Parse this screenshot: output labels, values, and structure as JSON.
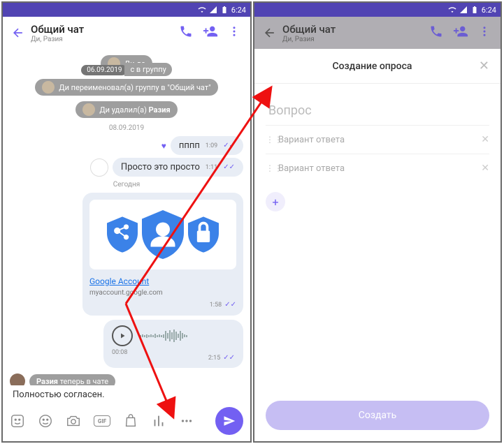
{
  "status": {
    "time": "6:24",
    "time_right": "6:24"
  },
  "left": {
    "header": {
      "title": "Общий чат",
      "subtitle": "Ди, Разия"
    },
    "sys_msgs": {
      "m1_prefix": "Ди до",
      "m1_date_pill": "06.09.2019",
      "m1_suffix": "с в группу",
      "m2": "Ди переименовал(а) группу в \"Общий чат\"",
      "m3_prefix": "Ди удалил(а) ",
      "m3_bold": "Разия"
    },
    "date1": "08.09.2019",
    "msg1": {
      "text": "пппп",
      "time": "1:09"
    },
    "msg2": {
      "text": "Просто это просто",
      "time": "1:11"
    },
    "date2": "Сегодня",
    "card": {
      "title": "Google Account",
      "subtitle": "myaccount.google.com",
      "time": "1:58"
    },
    "voice": {
      "dur": "00:08",
      "time": "2:15"
    },
    "incoming": {
      "name": "Разия",
      "text": " теперь в чате"
    },
    "suggestion": "Полностью согласен.",
    "gif_label": "GIF"
  },
  "right": {
    "header": {
      "title": "Общий чат",
      "subtitle": "Ди, Разия"
    },
    "poll": {
      "title": "Создание опроса",
      "question_placeholder": "Вопрос",
      "option_placeholder": "Вариант ответа",
      "create": "Создать"
    }
  }
}
